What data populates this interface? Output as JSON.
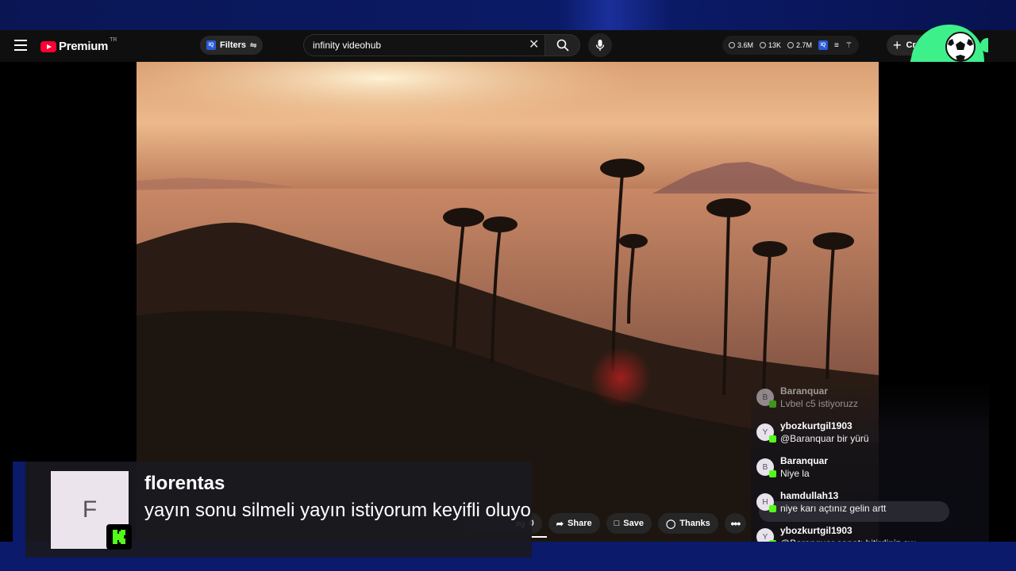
{
  "header": {
    "logo_text": "Premium",
    "logo_region": "TR",
    "filters_label": "Filters",
    "search_value": "infinity videohub",
    "stats": [
      {
        "icon": "clock-icon",
        "value": "3.6M"
      },
      {
        "icon": "eye-icon",
        "value": "13K"
      },
      {
        "icon": "views-icon",
        "value": "2.7M"
      }
    ],
    "create_label": "Cr"
  },
  "player": {
    "share_label": "Share",
    "save_label": "Save",
    "thanks_label": "Thanks",
    "dislike_count": "0"
  },
  "chat": {
    "messages": [
      {
        "initial": "B",
        "user": "Baranquar",
        "text": "Lvbel c5 istiyoruzz"
      },
      {
        "initial": "Y",
        "user": "ybozkurtgil1903",
        "text": "@Baranquar bir yürü"
      },
      {
        "initial": "B",
        "user": "Baranquar",
        "text": "Niye la"
      },
      {
        "initial": "H",
        "user": "hamdullah13",
        "text": "niye karı açtınız gelin artt"
      },
      {
        "initial": "Y",
        "user": "ybozkurtgil1903",
        "text": "@Baranquar sanatı bitirdiniz aw"
      }
    ]
  },
  "alert": {
    "avatar_initial": "F",
    "username": "florentas",
    "message": "yayın sonu silmeli yayın istiyorum keyifli oluyo"
  },
  "colors": {
    "youtube_red": "#ff0033",
    "kick_green": "#53fc18",
    "brand_green": "#3ef08a",
    "stream_blue": "#0b1a6a"
  }
}
